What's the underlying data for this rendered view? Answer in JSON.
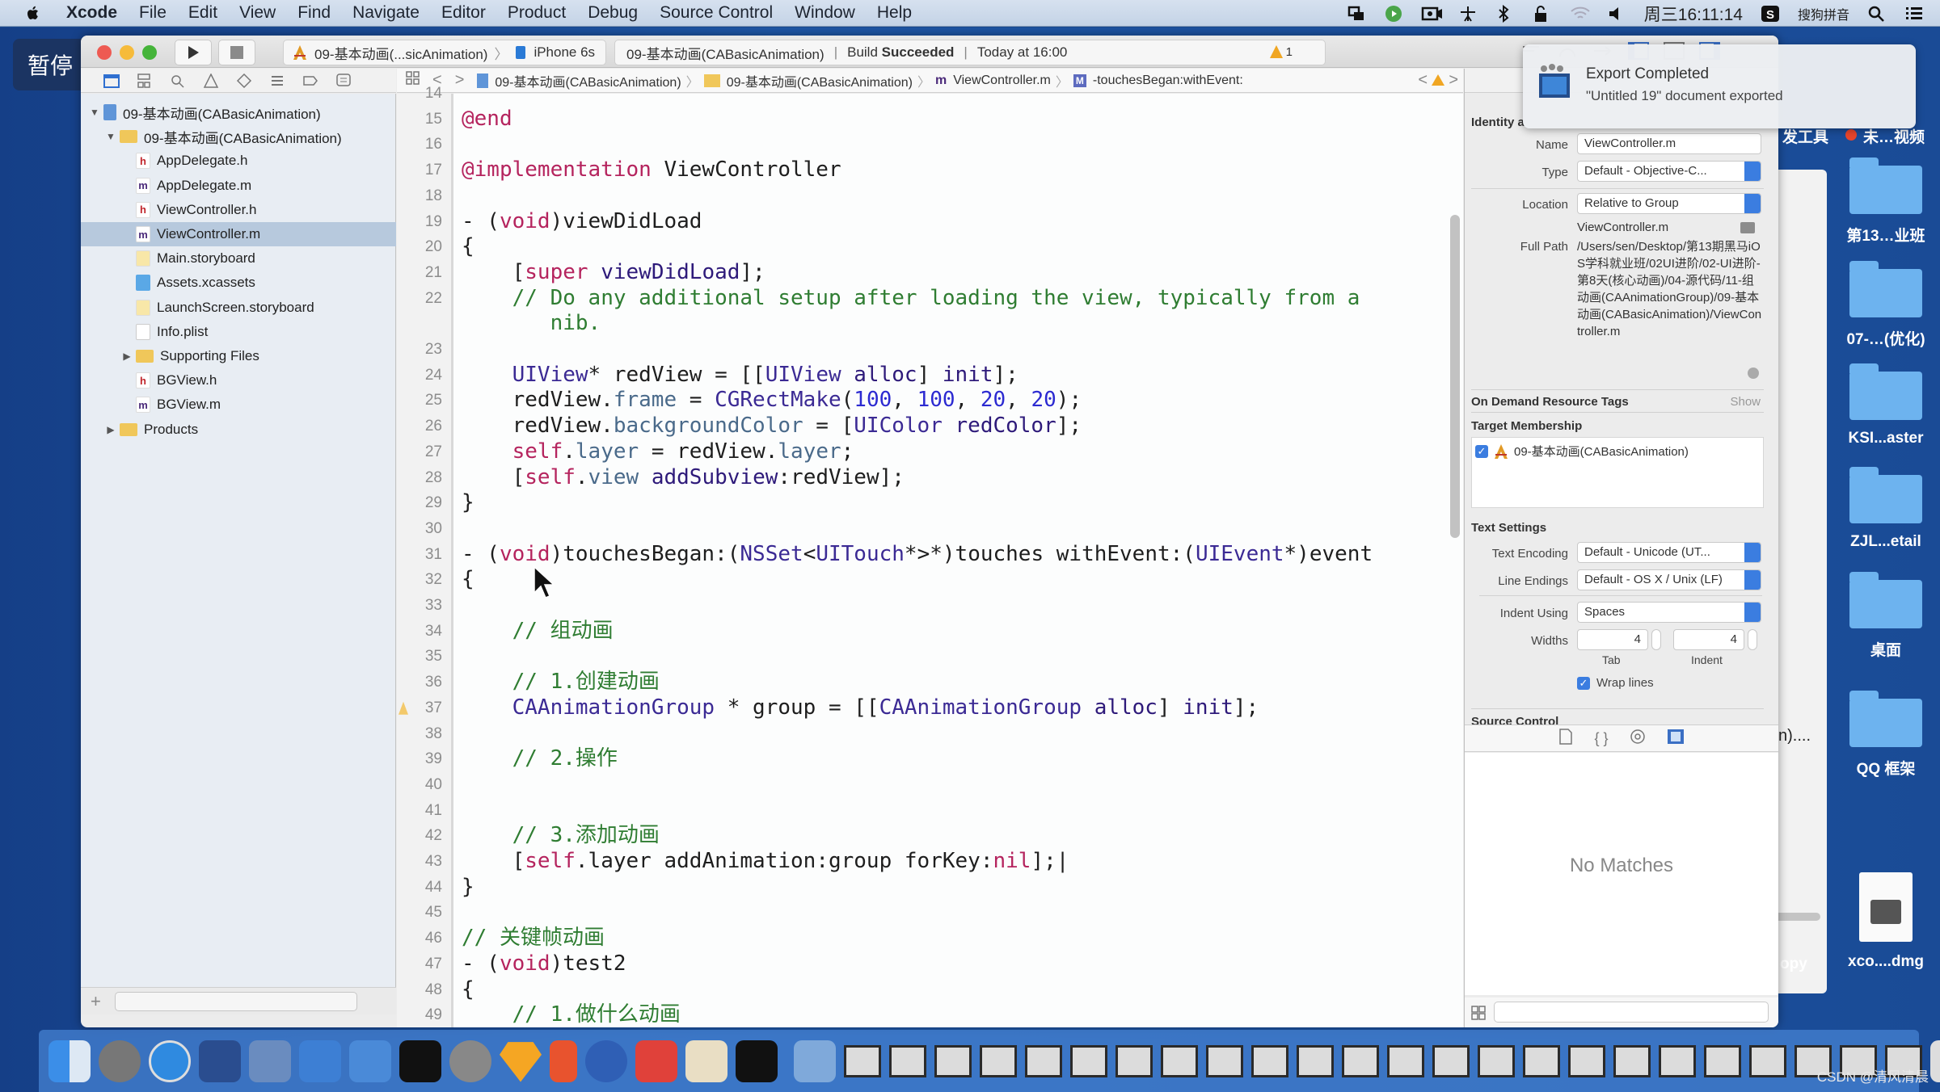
{
  "menubar": {
    "app": "Xcode",
    "items": [
      "File",
      "Edit",
      "View",
      "Find",
      "Navigate",
      "Editor",
      "Product",
      "Debug",
      "Source Control",
      "Window",
      "Help"
    ],
    "clock": "周三16:11:14",
    "input_method": "搜狗拼音"
  },
  "overlay": {
    "pause_label": "暂停"
  },
  "toolbar": {
    "scheme": "09-基本动画(...sicAnimation)",
    "device": "iPhone 6s",
    "activity_project": "09-基本动画(CABasicAnimation)",
    "build_prefix": "Build",
    "build_status": "Succeeded",
    "build_time": "Today at 16:00",
    "warning_count": "1"
  },
  "jumpbar": {
    "crumbs": [
      "09-基本动画(CABasicAnimation)",
      "09-基本动画(CABasicAnimation)",
      "ViewController.m",
      "-touchesBegan:withEvent:"
    ]
  },
  "navigator": {
    "items": [
      {
        "label": "09-基本动画(CABasicAnimation)",
        "icon": "project",
        "level": 0,
        "expanded": true
      },
      {
        "label": "09-基本动画(CABasicAnimation)",
        "icon": "folder",
        "level": 1,
        "expanded": true
      },
      {
        "label": "AppDelegate.h",
        "icon": "h",
        "level": 2
      },
      {
        "label": "AppDelegate.m",
        "icon": "m",
        "level": 2
      },
      {
        "label": "ViewController.h",
        "icon": "h",
        "level": 2
      },
      {
        "label": "ViewController.m",
        "icon": "m",
        "level": 2,
        "selected": true
      },
      {
        "label": "Main.storyboard",
        "icon": "storyboard",
        "level": 2
      },
      {
        "label": "Assets.xcassets",
        "icon": "assets",
        "level": 2
      },
      {
        "label": "LaunchScreen.storyboard",
        "icon": "storyboard",
        "level": 2
      },
      {
        "label": "Info.plist",
        "icon": "plist",
        "level": 2
      },
      {
        "label": "Supporting Files",
        "icon": "folder",
        "level": 2,
        "expanded": false
      },
      {
        "label": "BGView.h",
        "icon": "h",
        "level": 2
      },
      {
        "label": "BGView.m",
        "icon": "m",
        "level": 2
      },
      {
        "label": "Products",
        "icon": "folder",
        "level": 1,
        "expanded": false
      }
    ]
  },
  "editor": {
    "lines": [
      {
        "n": "14",
        "html": ""
      },
      {
        "n": "15",
        "html": "<span class='kw'>@end</span>"
      },
      {
        "n": "16",
        "html": ""
      },
      {
        "n": "17",
        "html": "<span class='kw'>@implementation</span> ViewController"
      },
      {
        "n": "18",
        "html": ""
      },
      {
        "n": "19",
        "html": "- (<span class='kw'>void</span>)viewDidLoad"
      },
      {
        "n": "20",
        "html": "{"
      },
      {
        "n": "21",
        "html": "    [<span class='kw'>super</span> <span class='mth'>viewDidLoad</span>];"
      },
      {
        "n": "22",
        "html": "    <span class='cmt'>// Do any additional setup after loading the view, typically from a</span>"
      },
      {
        "n": "",
        "html": "<span class='cmt'>       nib.</span>"
      },
      {
        "n": "23",
        "html": ""
      },
      {
        "n": "24",
        "html": "    <span class='cls'>UIView</span>* redView = [[<span class='cls'>UIView</span> <span class='mth'>alloc</span>] <span class='mth'>init</span>];"
      },
      {
        "n": "25",
        "html": "    redView.<span class='prop'>frame</span> = <span class='cls'>CGRectMake</span>(<span class='num'>100</span>, <span class='num'>100</span>, <span class='num'>20</span>, <span class='num'>20</span>);"
      },
      {
        "n": "26",
        "html": "    redView.<span class='prop'>backgroundColor</span> = [<span class='cls'>UIColor</span> <span class='mth'>redColor</span>];"
      },
      {
        "n": "27",
        "html": "    <span class='kw'>self</span>.<span class='prop'>layer</span> = redView.<span class='prop'>layer</span>;"
      },
      {
        "n": "28",
        "html": "    [<span class='kw'>self</span>.<span class='prop'>view</span> <span class='mth'>addSubview</span>:redView];"
      },
      {
        "n": "29",
        "html": "}"
      },
      {
        "n": "30",
        "html": ""
      },
      {
        "n": "31",
        "html": "- (<span class='kw'>void</span>)touchesBegan:(<span class='cls'>NSSet</span>&lt;<span class='cls'>UITouch</span>*&gt;*)touches withEvent:(<span class='cls'>UIEvent</span>*)event"
      },
      {
        "n": "32",
        "html": "{"
      },
      {
        "n": "33",
        "html": ""
      },
      {
        "n": "34",
        "html": "    <span class='cmt'>// 组动画</span>"
      },
      {
        "n": "35",
        "html": ""
      },
      {
        "n": "36",
        "html": "    <span class='cmt'>// 1.创建动画</span>"
      },
      {
        "n": "37",
        "html": "    <span class='cls'>CAAnimationGroup</span> * group = [[<span class='cls'>CAAnimationGroup</span> <span class='mth'>alloc</span>] <span class='mth'>init</span>];",
        "warn": true
      },
      {
        "n": "38",
        "html": ""
      },
      {
        "n": "39",
        "html": "    <span class='cmt'>// 2.操作</span>"
      },
      {
        "n": "40",
        "html": ""
      },
      {
        "n": "41",
        "html": ""
      },
      {
        "n": "42",
        "html": "    <span class='cmt'>// 3.添加动画</span>"
      },
      {
        "n": "43",
        "html": "    [<span class='kw'>self</span>.layer addAnimation:group forKey:<span class='kw'>nil</span>];|"
      },
      {
        "n": "44",
        "html": "}"
      },
      {
        "n": "45",
        "html": ""
      },
      {
        "n": "46",
        "html": "<span class='cmt'>// 关键帧动画</span>"
      },
      {
        "n": "47",
        "html": "- (<span class='kw'>void</span>)test2"
      },
      {
        "n": "48",
        "html": "{"
      },
      {
        "n": "49",
        "html": "    <span class='cmt'>// 1.做什么动画</span>"
      }
    ]
  },
  "inspector": {
    "identity_header": "Identity a",
    "name_label": "Name",
    "name_value": "ViewController.m",
    "type_label": "Type",
    "type_value": "Default - Objective-C...",
    "location_label": "Location",
    "location_value": "Relative to Group",
    "location_file": "ViewController.m",
    "full_path_label": "Full Path",
    "full_path": "/Users/sen/Desktop/第13期黑马iOS学科就业班/02UI进阶/02-UI进阶-第8天(核心动画)/04-源代码/11-组动画(CAAnimationGroup)/09-基本动画(CABasicAnimation)/ViewController.m",
    "odr_header": "On Demand Resource Tags",
    "odr_show": "Show",
    "target_header": "Target Membership",
    "target_name": "09-基本动画(CABasicAnimation)",
    "text_settings_header": "Text Settings",
    "encoding_label": "Text Encoding",
    "encoding_value": "Default - Unicode (UT...",
    "line_endings_label": "Line Endings",
    "line_endings_value": "Default - OS X / Unix (LF)",
    "indent_using_label": "Indent Using",
    "indent_using_value": "Spaces",
    "widths_label": "Widths",
    "tab_width": "4",
    "indent_width": "4",
    "tab_label": "Tab",
    "indent_label": "Indent",
    "wrap_lines_label": "Wrap lines",
    "source_control_header": "Source Control",
    "library_empty": "No Matches"
  },
  "notification": {
    "title": "Export Completed",
    "body": "\"Untitled 19\" document exported"
  },
  "desktop": {
    "top_labels": [
      "发工具",
      "未…视频"
    ],
    "icons": [
      "第13…业班",
      "07-…(优化)",
      "KSI...aster",
      "ZJL...etail",
      "桌面",
      "QQ 框架",
      "xco....dmg"
    ],
    "partial_labels": [
      "n)....",
      "opy"
    ]
  },
  "watermark": "CSDN @清风清晨"
}
